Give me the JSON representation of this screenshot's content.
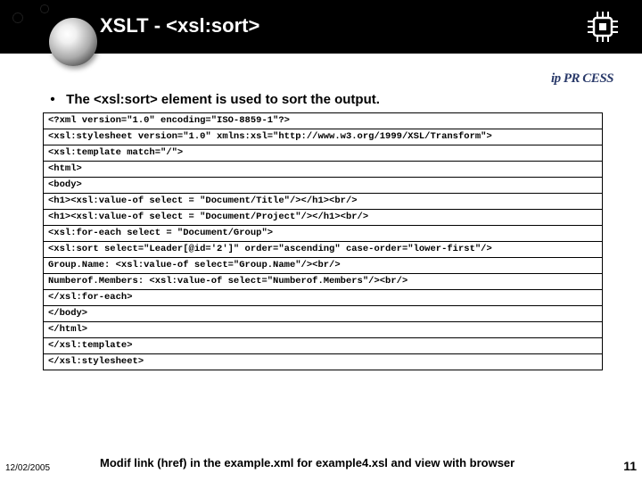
{
  "header": {
    "title": "XSLT - <xsl:sort>",
    "logo_text": "ip PR CESS"
  },
  "bullet": {
    "text": "The <xsl:sort> element is used to sort the output."
  },
  "code": {
    "l1": "<?xml version=\"1.0\" encoding=\"ISO-8859-1\"?>",
    "l2": "<xsl:stylesheet version=\"1.0\" xmlns:xsl=\"http://www.w3.org/1999/XSL/Transform\">",
    "l3": "<xsl:template match=\"/\">",
    "l4": "<html>",
    "l5": "<body>",
    "l6": "<h1><xsl:value-of select = \"Document/Title\"/></h1><br/>",
    "l7": "<h1><xsl:value-of select = \"Document/Project\"/></h1><br/>",
    "l8": "<xsl:for-each select = \"Document/Group\">",
    "l9": "<xsl:sort select=\"Leader[@id='2']\" order=\"ascending\" case-order=\"lower-first\"/>",
    "l10": "Group.Name: <xsl:value-of select=\"Group.Name\"/><br/>",
    "l11": "Numberof.Members: <xsl:value-of select=\"Numberof.Members\"/><br/>",
    "l12": "</xsl:for-each>",
    "l13": "</body>",
    "l14": "</html>",
    "l15": "</xsl:template>",
    "l16": "</xsl:stylesheet>"
  },
  "footer": {
    "instruction": "Modif link (href) in the example.xml for example4.xsl and view with browser",
    "date": "12/02/2005",
    "page": "11"
  }
}
